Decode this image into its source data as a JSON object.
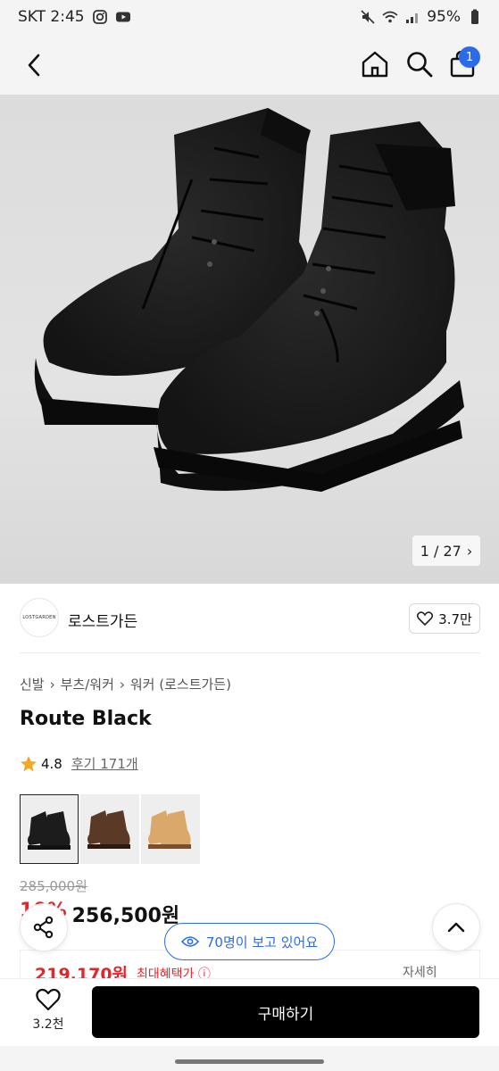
{
  "status_bar": {
    "carrier_time": "SKT 2:45",
    "battery": "95%"
  },
  "nav": {
    "cart_count": "1"
  },
  "hero": {
    "image_counter": "1 / 27",
    "chevron": "›"
  },
  "brand": {
    "logo_text": "LOSTGARDEN",
    "name": "로스트가든",
    "likes": "3.7만"
  },
  "breadcrumb": [
    "신발",
    "부츠/워커",
    "워커 (로스트가든)"
  ],
  "product": {
    "title": "Route Black",
    "rating": "4.8",
    "reviews": "후기 171개",
    "original_price": "285,000원",
    "discount_rate": "10%",
    "price": "256,500원"
  },
  "color_options": [
    {
      "name": "black",
      "color": "#1c1c1c",
      "sole": "#111111"
    },
    {
      "name": "brown",
      "color": "#5a3a26",
      "sole": "#2a1a10"
    },
    {
      "name": "wheat",
      "color": "#d9a86a",
      "sole": "#7a5130"
    }
  ],
  "promo": {
    "best_price": "219,170원",
    "label": "최대혜택가 ⓘ",
    "detail": "자세히"
  },
  "viewers": {
    "text": "70명이 보고 있어요"
  },
  "bottom": {
    "wish_count": "3.2천",
    "buy_label": "구매하기"
  },
  "colors": {
    "accent_blue": "#2c6be8",
    "sale_red": "#e0272c"
  }
}
